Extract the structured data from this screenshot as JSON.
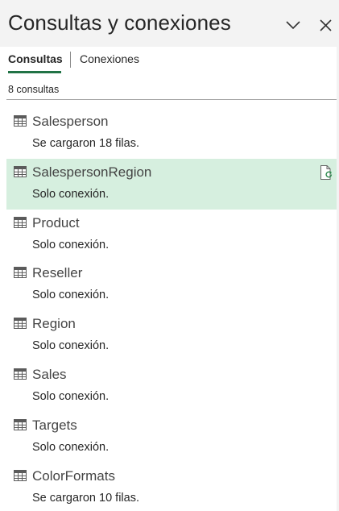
{
  "pane": {
    "title": "Consultas y conexiones"
  },
  "tabs": [
    {
      "label": "Consultas",
      "active": true
    },
    {
      "label": "Conexiones",
      "active": false
    }
  ],
  "count_label": "8 consultas",
  "queries": [
    {
      "name": "Salesperson",
      "status": "Se cargaron 18 filas."
    },
    {
      "name": "SalespersonRegion",
      "status": "Solo conexión.",
      "selected": true
    },
    {
      "name": "Product",
      "status": "Solo conexión."
    },
    {
      "name": "Reseller",
      "status": "Solo conexión."
    },
    {
      "name": "Region",
      "status": "Solo conexión."
    },
    {
      "name": "Sales",
      "status": "Solo conexión."
    },
    {
      "name": "Targets",
      "status": "Solo conexión."
    },
    {
      "name": "ColorFormats",
      "status": "Se cargaron 10 filas."
    }
  ],
  "colors": {
    "accent": "#217346",
    "selected_bg": "#d6efdf"
  },
  "icons": {
    "item": "table-icon",
    "selected_action": "refresh-icon"
  }
}
